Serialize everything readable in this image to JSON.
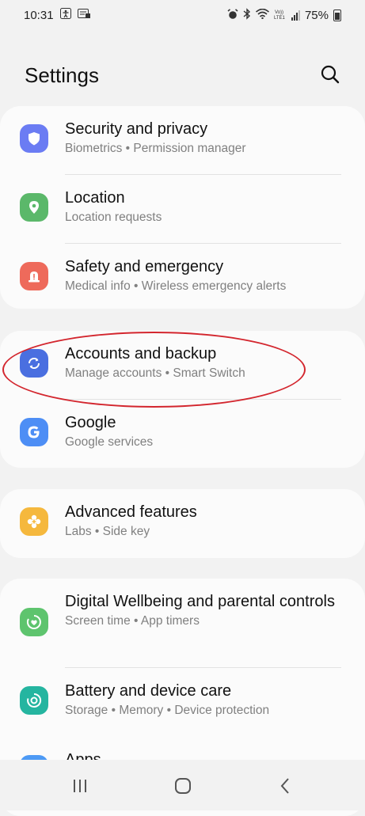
{
  "status_bar": {
    "time": "10:31",
    "battery": "75%"
  },
  "header": {
    "title": "Settings"
  },
  "groups": [
    {
      "items": [
        {
          "title": "Security and privacy",
          "subtitle": "Biometrics  •  Permission manager",
          "icon": "shield-icon",
          "color": "#6b7cf3"
        },
        {
          "title": "Location",
          "subtitle": "Location requests",
          "icon": "location-pin-icon",
          "color": "#5bb86a"
        },
        {
          "title": "Safety and emergency",
          "subtitle": "Medical info  •  Wireless emergency alerts",
          "icon": "siren-icon",
          "color": "#ee6a5b"
        }
      ]
    },
    {
      "items": [
        {
          "title": "Accounts and backup",
          "subtitle": "Manage accounts  •  Smart Switch",
          "icon": "sync-icon",
          "color": "#4a6fe0"
        },
        {
          "title": "Google",
          "subtitle": "Google services",
          "icon": "google-g-icon",
          "color": "#4d8ef5"
        }
      ]
    },
    {
      "items": [
        {
          "title": "Advanced features",
          "subtitle": "Labs  •  Side key",
          "icon": "plus-gear-icon",
          "color": "#f5b83d"
        }
      ]
    },
    {
      "items": [
        {
          "title": "Digital Wellbeing and parental controls",
          "subtitle": "Screen time  •  App timers",
          "icon": "heart-ring-icon",
          "color": "#5ec46e"
        },
        {
          "title": "Battery and device care",
          "subtitle": "Storage  •  Memory  •  Device protection",
          "icon": "device-care-icon",
          "color": "#25b5a0"
        },
        {
          "title": "Apps",
          "subtitle": "",
          "icon": "apps-icon",
          "color": "#4d9af5"
        }
      ]
    }
  ]
}
